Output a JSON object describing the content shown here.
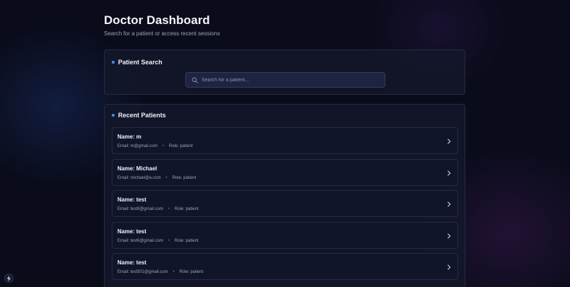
{
  "header": {
    "title": "Doctor Dashboard",
    "subtitle": "Search for a patient or access recent sessions"
  },
  "search": {
    "title": "Patient Search",
    "placeholder": "Search for a patient..."
  },
  "recent": {
    "title": "Recent Patients",
    "patients": [
      {
        "name": "Name: m",
        "email": "Email: m@gmail.com",
        "role": "Role: patient"
      },
      {
        "name": "Name: Michael",
        "email": "Email: michael@a.com",
        "role": "Role: patient"
      },
      {
        "name": "Name: test",
        "email": "Email: test8@gmail.com",
        "role": "Role: patient"
      },
      {
        "name": "Name: test",
        "email": "Email: test6@gmail.com",
        "role": "Role: patient"
      },
      {
        "name": "Name: test",
        "email": "Email: test501@gmail.com",
        "role": "Role: patient"
      }
    ]
  },
  "meta_separator": "•",
  "icons": {
    "search": "search-icon",
    "chevron": "chevron-right-icon",
    "dev": "lightning-icon"
  },
  "colors": {
    "accent": "#4a8cff",
    "background": "#0a0c1b",
    "card": "#14182a"
  }
}
